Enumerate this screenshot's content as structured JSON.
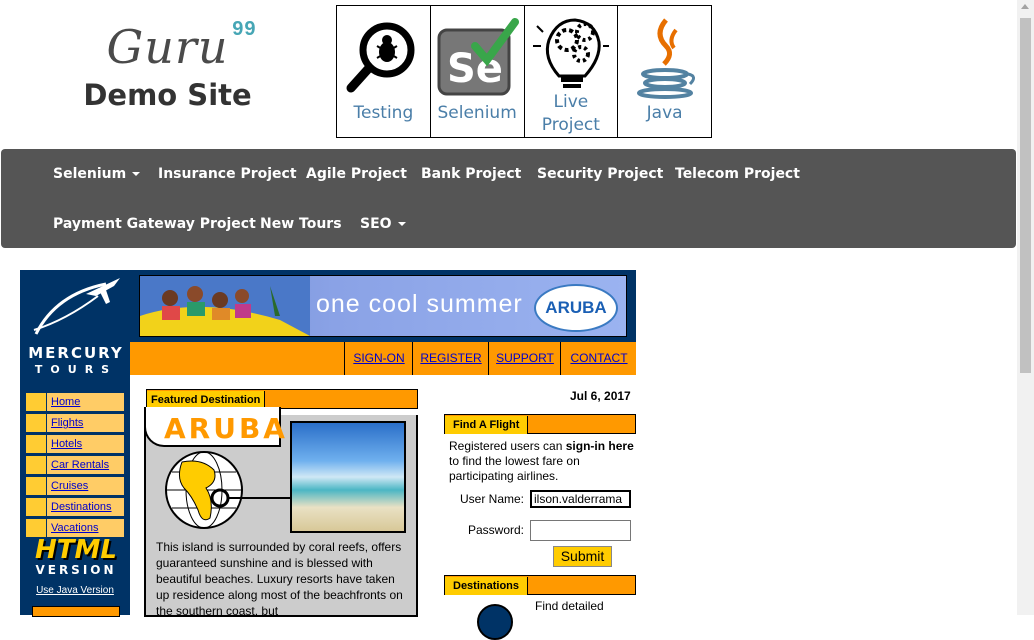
{
  "logo": {
    "brand": "Guru",
    "superscript": "99",
    "subtitle": "Demo Site"
  },
  "topics": [
    {
      "label": "Testing",
      "icon": "magnifier-bug-icon"
    },
    {
      "label": "Selenium",
      "icon": "selenium-se-icon"
    },
    {
      "label_line1": "Live",
      "label_line2": "Project",
      "icon": "lightbulb-gears-icon"
    },
    {
      "label": "Java",
      "icon": "java-cup-icon"
    }
  ],
  "nav": {
    "row1": [
      "Selenium",
      "Insurance Project",
      "Agile Project",
      "Bank Project",
      "Security Project",
      "Telecom Project"
    ],
    "row2": [
      "Payment Gateway Project",
      "New Tours",
      "SEO"
    ]
  },
  "mercury": {
    "brand_line1": "MERCURY",
    "brand_line2": "TOURS",
    "banner_text": "one cool summer",
    "banner_logo": "ARUBA",
    "top_links": [
      "SIGN-ON",
      "REGISTER",
      "SUPPORT",
      "CONTACT"
    ],
    "side_menu": [
      "Home",
      "Flights",
      "Hotels",
      "Car Rentals",
      "Cruises",
      "Destinations",
      "Vacations"
    ],
    "html_version_line1": "HTML",
    "html_version_line2": "VERSION",
    "java_link": "Use Java Version",
    "featured_header": "Featured Destination",
    "featured_title": "ARUBA",
    "featured_text": "This island is surrounded by coral reefs, offers guaranteed sunshine and is blessed with beautiful beaches. Luxury resorts have taken up residence along most of the beachfronts on the southern coast, but",
    "date": "Jul 6, 2017",
    "find_flight_header": "Find A Flight",
    "find_flight_text_pre": "Registered users can ",
    "find_flight_text_bold": "sign-in here",
    "find_flight_text_post": " to find the lowest fare on participating airlines.",
    "username_label": "User Name:",
    "username_value": "ilson.valderrama",
    "password_label": "Password:",
    "submit_label": "Submit",
    "destinations_header": "Destinations",
    "destinations_text": "Find detailed"
  },
  "colors": {
    "navbar": "#555555",
    "mercury_navy": "#003366",
    "mercury_orange": "#ff9900",
    "mercury_yellow": "#ffcc00",
    "topic_label": "#4a7ea8"
  }
}
